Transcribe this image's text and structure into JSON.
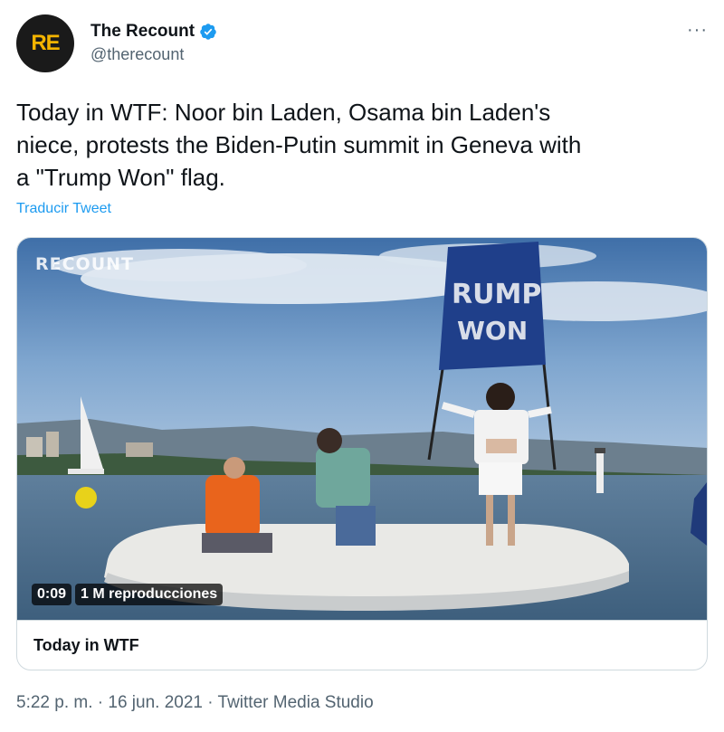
{
  "account": {
    "avatar_text": "RE",
    "name": "The Recount",
    "handle": "@therecount",
    "more_label": "···",
    "verified_icon": "verified-badge-icon",
    "avatar_color": "#1a1a1a",
    "avatar_text_color": "#f4b400"
  },
  "tweet": {
    "text_line1": "Today in WTF: Noor bin Laden, Osama bin Laden's",
    "text_line2": "niece, protests the Biden-Putin summit in Geneva with",
    "text_line3": "a \"Trump Won\" flag.",
    "translate_label": "Traducir Tweet"
  },
  "media": {
    "watermark": "RECOUNT",
    "flag_text_line1": "RUMP",
    "flag_text_line2": "WON",
    "duration": "0:09",
    "views": "1 M reproducciones",
    "card_title": "Today in WTF"
  },
  "footer": {
    "time": "5:22 p. m.",
    "separator1": " · ",
    "date": "16 jun. 2021",
    "separator2": " · ",
    "source": "Twitter Media Studio"
  },
  "colors": {
    "link": "#1d9bf0",
    "secondary_text": "#536471",
    "border": "#cfd9de"
  }
}
